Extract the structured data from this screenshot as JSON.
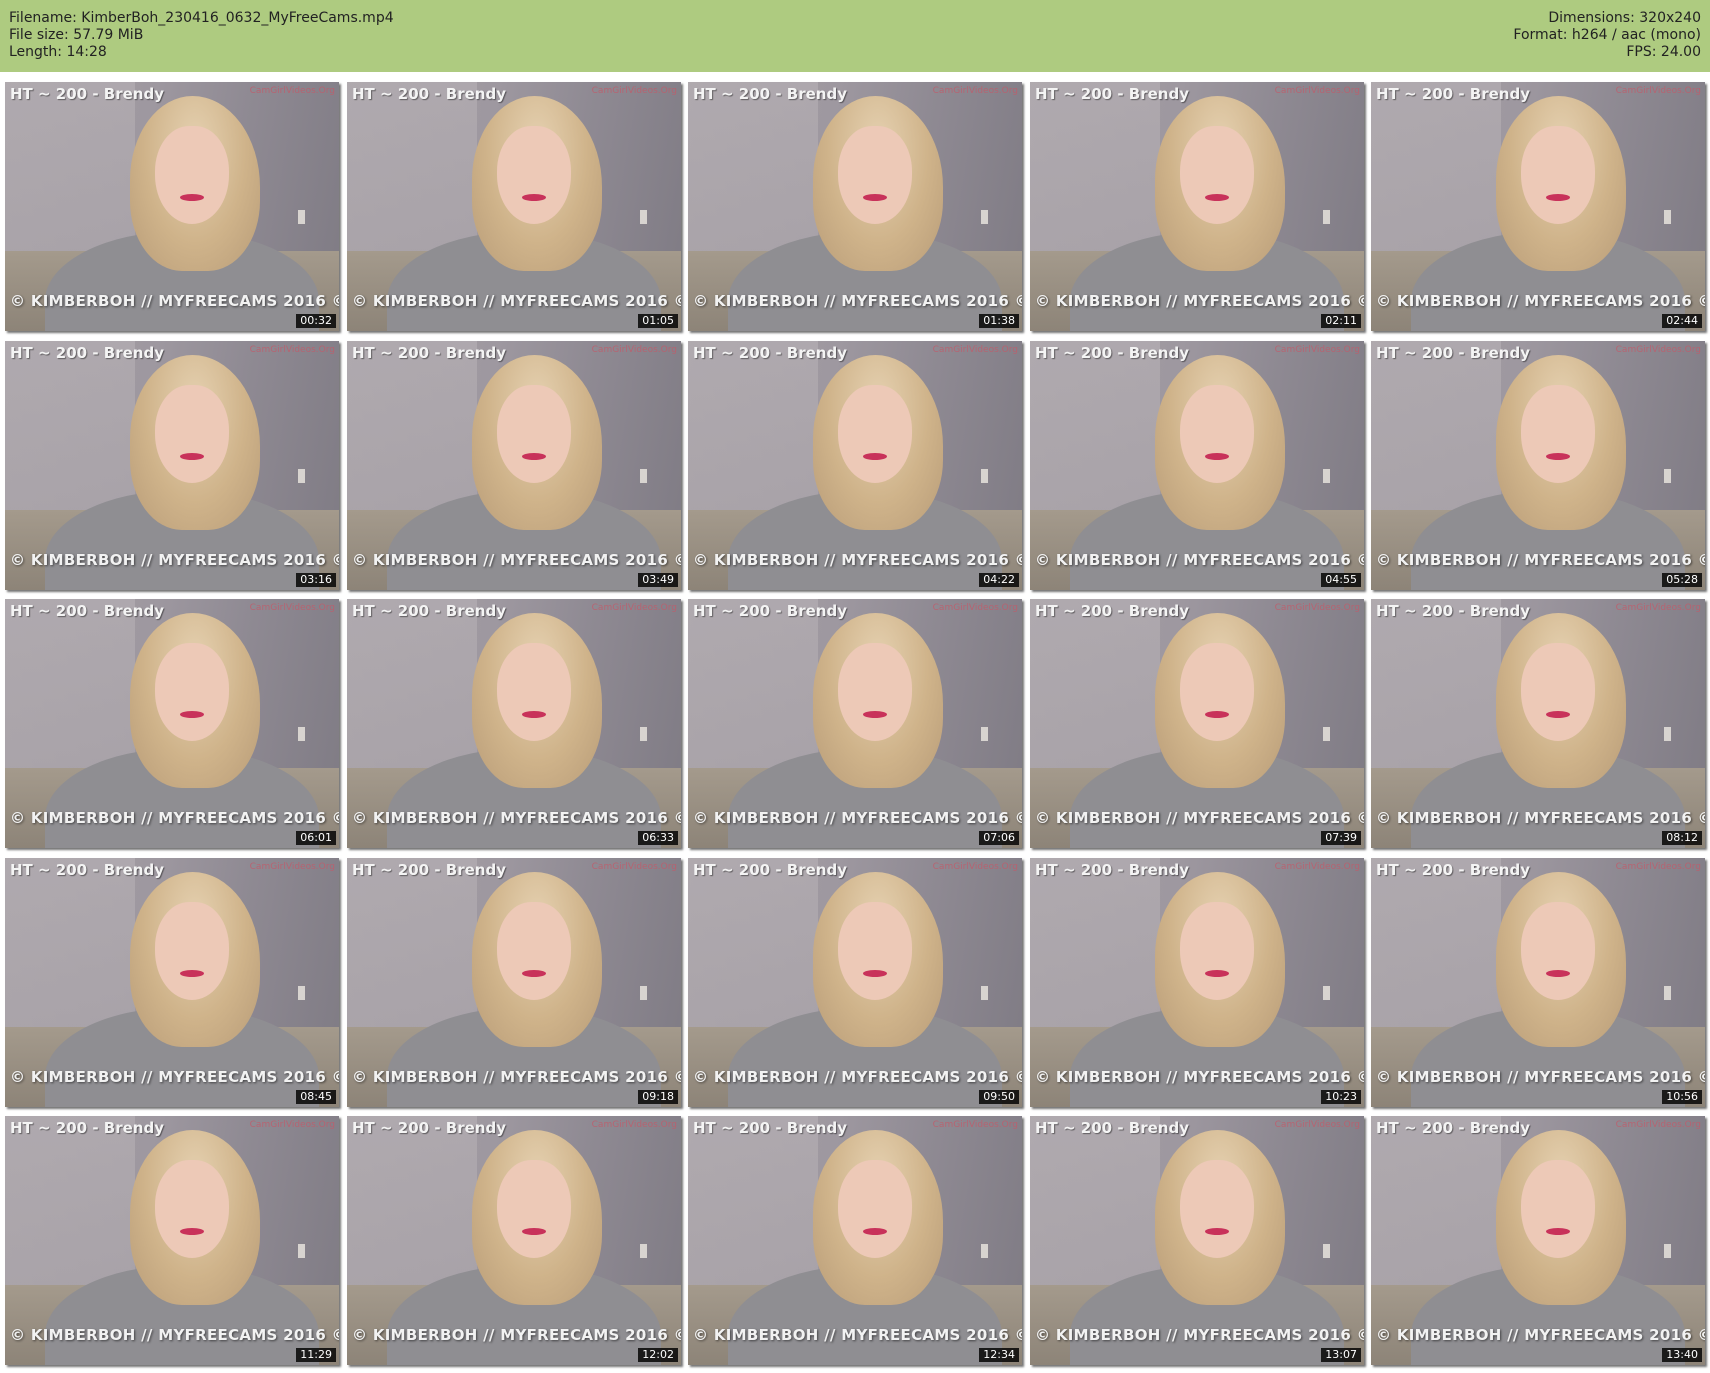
{
  "header": {
    "filename": "Filename: KimberBoh_230416_0632_MyFreeCams.mp4",
    "file_size": "File size: 57.79 MiB",
    "length": "Length: 14:28",
    "dimensions": "Dimensions: 320x240",
    "format": "Format: h264 / aac (mono)",
    "fps": "FPS: 24.00",
    "background_color": "#aecb80"
  },
  "thumbnail_caption_top": "HT ~ 200 - Brendy",
  "thumbnail_caption_bottom": "© KIMBERBOH // MYFREECAMS 2016 ©",
  "thumbnail_logo": "CamGirlVideos.Org",
  "thumbnails": [
    {
      "timestamp": "00:32"
    },
    {
      "timestamp": "01:05"
    },
    {
      "timestamp": "01:38"
    },
    {
      "timestamp": "02:11"
    },
    {
      "timestamp": "02:44"
    },
    {
      "timestamp": "03:16"
    },
    {
      "timestamp": "03:49"
    },
    {
      "timestamp": "04:22"
    },
    {
      "timestamp": "04:55"
    },
    {
      "timestamp": "05:28"
    },
    {
      "timestamp": "06:01"
    },
    {
      "timestamp": "06:33"
    },
    {
      "timestamp": "07:06"
    },
    {
      "timestamp": "07:39"
    },
    {
      "timestamp": "08:12"
    },
    {
      "timestamp": "08:45"
    },
    {
      "timestamp": "09:18"
    },
    {
      "timestamp": "09:50"
    },
    {
      "timestamp": "10:23"
    },
    {
      "timestamp": "10:56"
    },
    {
      "timestamp": "11:29"
    },
    {
      "timestamp": "12:02"
    },
    {
      "timestamp": "12:34"
    },
    {
      "timestamp": "13:07"
    },
    {
      "timestamp": "13:40"
    }
  ]
}
